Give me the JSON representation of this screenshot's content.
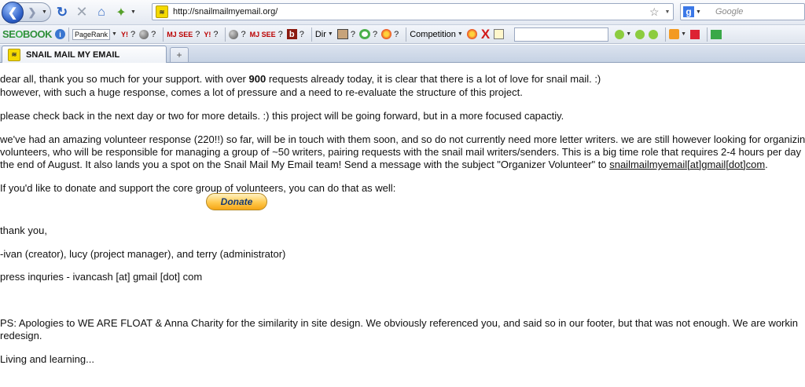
{
  "browser": {
    "url": "http://snailmailmyemail.org/",
    "search_placeholder": "Google",
    "tab_title": "SNAIL MAIL MY EMAIL",
    "favicon_text": "≋",
    "new_tab_symbol": "+"
  },
  "seobar": {
    "logo_prefix": "SE",
    "logo_suffix": "BOOK",
    "logo_o": "O",
    "pagerank_label": "PageRank",
    "question": "?",
    "mj_label": "MJ SEE",
    "yahoo_label": "Y!",
    "b_label": "b",
    "dir_label": "Dir",
    "competition_label": "Competition",
    "x_label": "X"
  },
  "content": {
    "p1_pre": "dear all, thank you so much for your support. with over ",
    "p1_bold": "900",
    "p1_post": " requests already today, it is clear that there is a lot of love for snail mail. :)",
    "p2": "however, with such a huge response, comes a lot of pressure and a need to re-evaluate the structure of this project.",
    "p3": "please check back in the next day or two for more details. :) this project will be going forward, but in a more focused capactiy.",
    "p4_l1": "we've had an amazing volunteer response (220!!) so far, will be in touch with them soon, and so do not currently need more letter writers. we are still however looking for organizing",
    "p4_l2": "volunteers, who will be responsible for managing a group of ~50 writers, pairing requests with the snail mail writers/senders. This is a big time role that requires 2-4 hours per day",
    "p4_l3_pre": "the end of August. It also lands you a spot on the Snail Mail My Email team! Send a message with the subject \"Organizer Volunteer\" to ",
    "p4_email": "snailmailmyemail[at]gmail[dot]com",
    "p4_l3_post": ".",
    "p5": "If you'd like to donate and support the core group of volunteers, you can do that as well:",
    "donate_label": "Donate",
    "p6": "thank you,",
    "p7": "-ivan (creator), lucy (project manager), and terry (administrator)",
    "p8": "press inquries - ivancash [at] gmail [dot] com",
    "p9_l1": "PS: Apologies to WE ARE FLOAT & Anna Charity for the similarity in site design. We obviously referenced you, and said so in our footer, but that was not enough. We are workin",
    "p9_l2": "redesign.",
    "p10": "Living and learning..."
  }
}
